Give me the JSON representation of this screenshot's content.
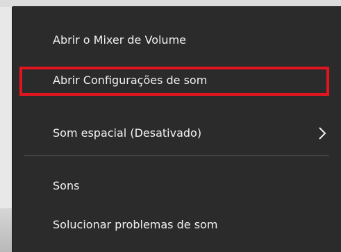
{
  "context_menu": {
    "items": [
      {
        "label": "Abrir o Mixer de Volume"
      },
      {
        "label": "Abrir Configurações de som"
      },
      {
        "label": "Som espacial (Desativado)",
        "has_submenu": true
      },
      {
        "label": "Sons"
      },
      {
        "label": "Solucionar problemas de som"
      }
    ]
  },
  "colors": {
    "menu_background": "#2b2b2b",
    "text": "#f2f2f2",
    "highlight_border": "#e2151f",
    "divider": "#5a5a5a"
  },
  "icons": {
    "submenu": "chevron-right-icon"
  }
}
